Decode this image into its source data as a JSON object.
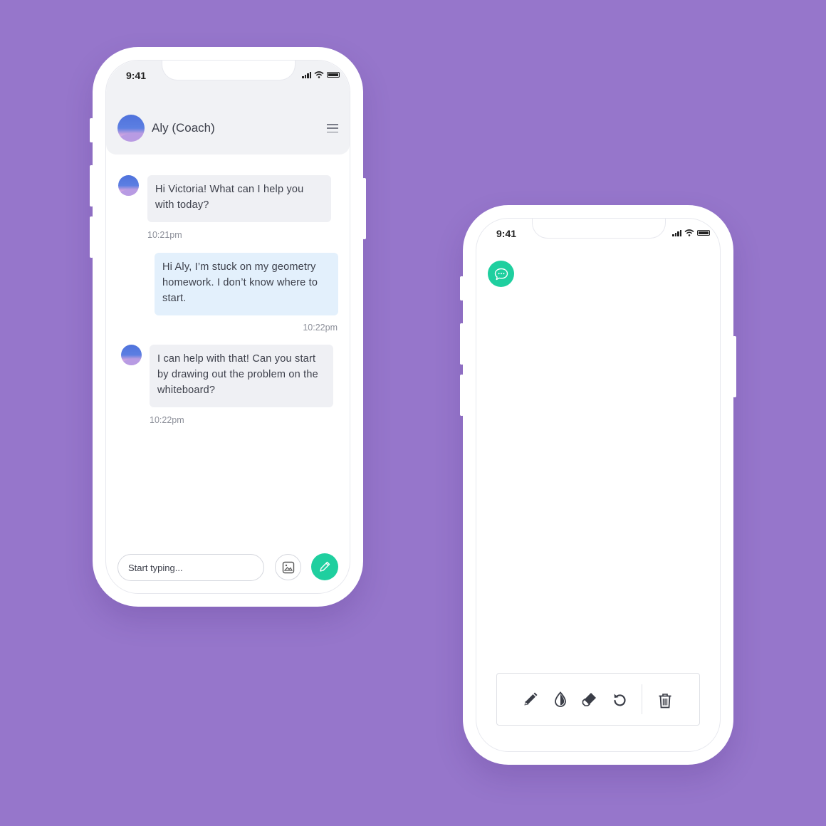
{
  "colors": {
    "background": "#9676cb",
    "accent_green": "#1fcf9f",
    "user_bubble": "#e3f0fc",
    "coach_bubble": "#eff0f4"
  },
  "chat_phone": {
    "status_time": "9:41",
    "header": {
      "coach_name": "Aly (Coach)",
      "menu_icon": "hamburger-menu-icon"
    },
    "messages": [
      {
        "sender": "coach",
        "text": "Hi Victoria! What can I help you with today?",
        "time": "10:21pm"
      },
      {
        "sender": "user",
        "text": "Hi Aly, I’m stuck on my geometry homework. I don’t know where to start.",
        "time": "10:22pm"
      },
      {
        "sender": "coach",
        "text": "I can help with that! Can you start by drawing out the problem on the whiteboard?",
        "time": "10:22pm"
      }
    ],
    "composer": {
      "placeholder": "Start typing...",
      "image_button_icon": "image-icon",
      "whiteboard_button_icon": "pencil-icon"
    }
  },
  "whiteboard_phone": {
    "status_time": "9:41",
    "chat_button_icon": "chat-bubble-icon",
    "tools": [
      {
        "name": "pencil",
        "icon": "pencil-icon"
      },
      {
        "name": "color",
        "icon": "ink-drop-icon"
      },
      {
        "name": "eraser",
        "icon": "eraser-icon"
      },
      {
        "name": "undo",
        "icon": "undo-icon"
      },
      {
        "name": "delete",
        "icon": "trash-icon"
      }
    ]
  }
}
